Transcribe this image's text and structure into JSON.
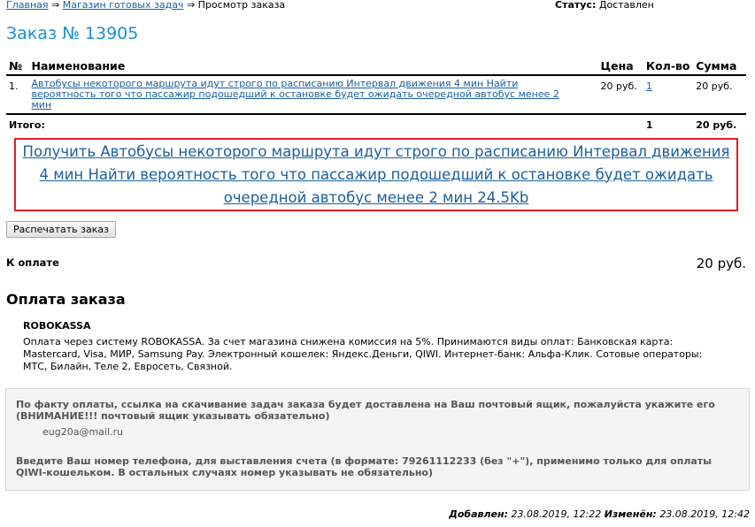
{
  "breadcrumb": {
    "home": "Главная",
    "shop": "Магазин готовых задач",
    "separator": "⇒",
    "current": "Просмотр заказа"
  },
  "status": {
    "label": "Статус:",
    "value": "Доставлен"
  },
  "order": {
    "title": "Заказ № 13905"
  },
  "items_table": {
    "headers": {
      "num": "№",
      "name": "Наименование",
      "price": "Цена",
      "qty": "Кол-во",
      "sum": "Сумма"
    },
    "rows": [
      {
        "num": "1.",
        "name": "Автобусы некоторого маршрута идут строго по расписанию Интервал движения 4 мин Найти вероятность того что пассажир подошедший к остановке будет ожидать очередной автобус менее 2 мин",
        "price": "20 руб.",
        "qty": "1",
        "sum": "20 руб."
      }
    ],
    "total": {
      "label": "Итого:",
      "qty": "1",
      "sum": "20 руб."
    }
  },
  "download": {
    "link_text": "Получить Автобусы некоторого маршрута идут строго по расписанию Интервал движения 4 мин Найти вероятность того что пассажир подошедший к остановке будет ожидать очередной автобус менее 2 мин 24.5Kb"
  },
  "print_button": "Распечатать заказ",
  "to_pay": {
    "label": "К оплате",
    "amount": "20 руб."
  },
  "payment": {
    "title": "Оплата заказа",
    "method_name": "ROBOKASSA",
    "method_desc": "Оплата через систему ROBOKASSA. За счет магазина снижена комиссия на 5%. Принимаются виды оплат: Банковская карта: Mastercard, Visa, МИР, Samsung Pay. Электронный кошелек: Яндекс.Деньги, QIWI. Интернет-банк: Альфа-Клик. Сотовые операторы: МТС, Билайн, Теле 2, Евросеть, Связной."
  },
  "delivery": {
    "email_note": "По факту оплаты, ссылка на скачивание задач заказа будет доставлена на Ваш почтовый ящик, пожалуйста укажите его (ВНИМАНИЕ!!! почтовый ящик указывать обязательно)",
    "email_value": "eug20a@mail.ru",
    "phone_note": "Введите Ваш номер телефона, для выставления счета (в формате: 79261112233 (без \"+\"), применимо только для оплаты QIWI-кошельком. В остальных случаях номер указывать не обязательно)"
  },
  "footer": {
    "added_label": "Добавлен:",
    "added_value": "23.08.2019, 12:22",
    "modified_label": "Изменён:",
    "modified_value": "23.08.2019, 12:42"
  },
  "colors": {
    "link": "#1a5fa0",
    "title": "#1a8fd6",
    "highlight_border": "#e0202a",
    "box_bg": "#f4f4f4"
  }
}
